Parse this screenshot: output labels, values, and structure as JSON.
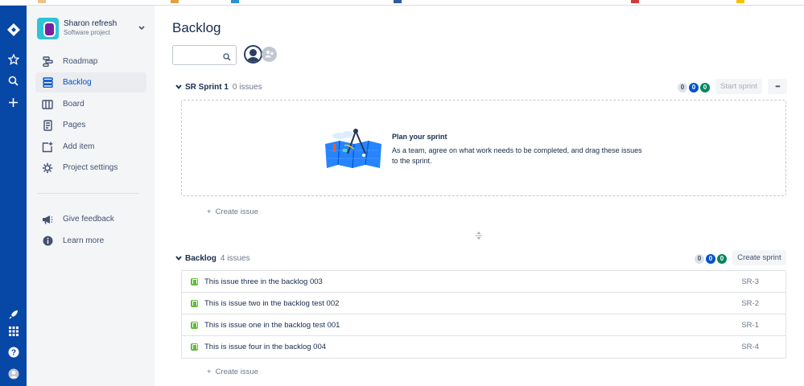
{
  "project": {
    "name": "Sharon refresh",
    "type": "Software project"
  },
  "sidebar": {
    "items": [
      {
        "label": "Roadmap",
        "icon": "roadmap-icon"
      },
      {
        "label": "Backlog",
        "icon": "backlog-icon",
        "active": true
      },
      {
        "label": "Board",
        "icon": "board-icon"
      },
      {
        "label": "Pages",
        "icon": "pages-icon"
      },
      {
        "label": "Add item",
        "icon": "add-item-icon"
      },
      {
        "label": "Project settings",
        "icon": "gear-icon"
      }
    ],
    "footer": [
      {
        "label": "Give feedback",
        "icon": "megaphone-icon"
      },
      {
        "label": "Learn more",
        "icon": "info-icon"
      }
    ]
  },
  "page": {
    "title": "Backlog"
  },
  "search": {
    "value": "",
    "placeholder": ""
  },
  "sprint": {
    "name": "SR Sprint 1",
    "count_label": "0 issues",
    "badges": [
      "0",
      "0",
      "0"
    ],
    "start_label": "Start sprint",
    "more_label": "•••",
    "empty_title": "Plan your sprint",
    "empty_desc": "As a team, agree on what work needs to be completed, and drag these issues to the sprint.",
    "create_label": "Create issue"
  },
  "backlog": {
    "name": "Backlog",
    "count_label": "4 issues",
    "badges": [
      "0",
      "0",
      "0"
    ],
    "create_sprint_label": "Create sprint",
    "create_label": "Create issue",
    "issues": [
      {
        "summary": "This issue three in the backlog 003",
        "key": "SR-3"
      },
      {
        "summary": "This is issue two in the backlog test 002",
        "key": "SR-2"
      },
      {
        "summary": "This is issue one in the backlog test 001",
        "key": "SR-1"
      },
      {
        "summary": "This is issue four in the backlog 004",
        "key": "SR-4"
      }
    ]
  },
  "colors": {
    "global_nav": "#0747a6",
    "accent": "#0052cc",
    "story": "#63ba3c",
    "done_badge": "#00875a"
  }
}
